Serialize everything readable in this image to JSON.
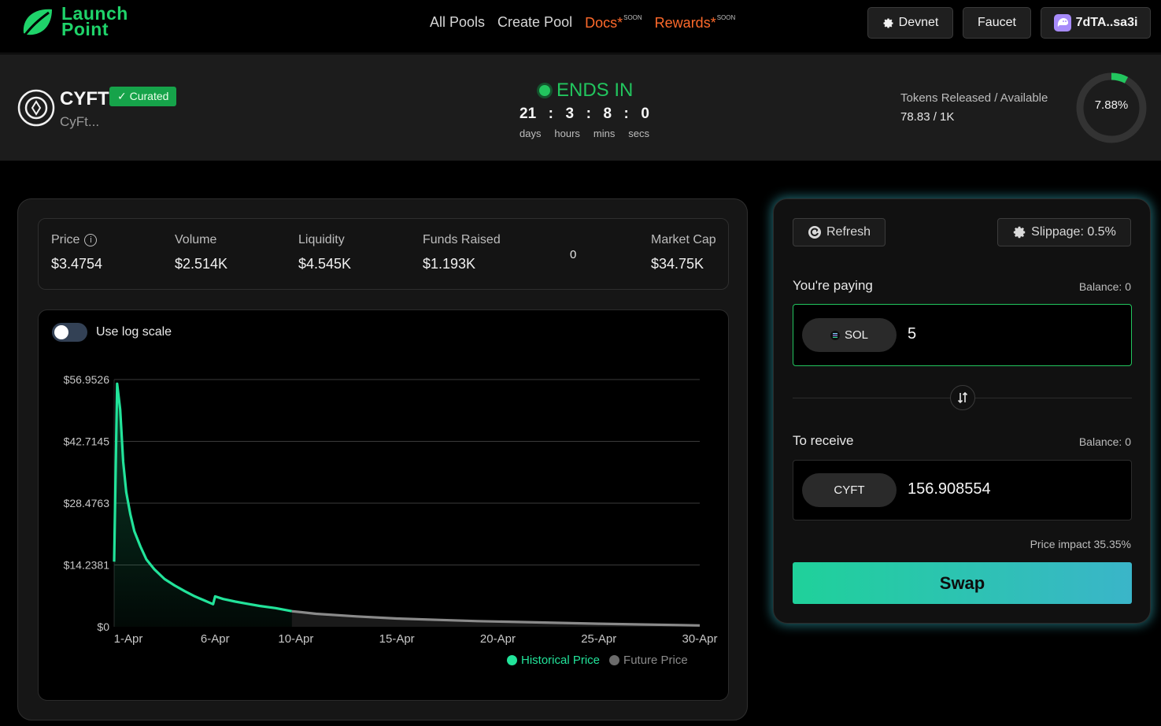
{
  "nav": {
    "logo_line1": "Launch",
    "logo_line2": "Point",
    "links": [
      {
        "label": "All Pools"
      },
      {
        "label": "Create Pool"
      },
      {
        "label": "Docs*",
        "badge": "SOON"
      },
      {
        "label": "Rewards*",
        "badge": "SOON"
      }
    ],
    "network_button": "Devnet",
    "faucet_button": "Faucet",
    "wallet_button": "7dTA..sa3i",
    "brand_color": "#1fd36a",
    "soon_color": "#ff6a2b"
  },
  "token": {
    "symbol": "CYFT",
    "curated_label": "✓ Curated",
    "name": "CyFt...",
    "ends_in_label": "ENDS IN",
    "countdown": {
      "days": "21",
      "hours": "3",
      "mins": "8",
      "secs": "0",
      "days_label": "days",
      "hours_label": "hours",
      "mins_label": "mins",
      "secs_label": "secs"
    },
    "released_label": "Tokens Released / Available",
    "released_value": "78.83 / 1K",
    "released_percent_text": "7.88%",
    "released_fraction": 0.0788
  },
  "stats": {
    "price_label": "Price",
    "price_value": "$3.4754",
    "volume_label": "Volume",
    "volume_value": "$2.514K",
    "liquidity_label": "Liquidity",
    "liquidity_value": "$4.545K",
    "funds_label": "Funds Raised",
    "funds_value": "$1.193K",
    "extra_value": "0",
    "mcap_label": "Market Cap",
    "mcap_value": "$34.75K"
  },
  "chart_toggle_label": "Use log scale",
  "chart_data": {
    "type": "area",
    "log_scale": false,
    "y_ticks": [
      "$56.9526",
      "$42.7145",
      "$28.4763",
      "$14.2381",
      "$0"
    ],
    "y_tick_values": [
      56.9526,
      42.7145,
      28.4763,
      14.2381,
      0
    ],
    "ylim": [
      0,
      56.9526
    ],
    "x_ticks": [
      "1-Apr",
      "6-Apr",
      "10-Apr",
      "15-Apr",
      "20-Apr",
      "25-Apr",
      "30-Apr"
    ],
    "x_tick_days": [
      1,
      6,
      10,
      15,
      20,
      25,
      30
    ],
    "xlim": [
      1,
      30
    ],
    "grid": true,
    "legend_position": "bottom-right",
    "series": [
      {
        "name": "Historical Price",
        "color": "#22e39a",
        "x": [
          1.0,
          1.15,
          1.3,
          1.45,
          1.6,
          1.8,
          2.0,
          2.3,
          2.6,
          3.0,
          3.5,
          4.0,
          4.5,
          5.0,
          5.5,
          5.9,
          6.0,
          6.4,
          7.0,
          7.6,
          8.2,
          9.0,
          9.8
        ],
        "values": [
          15.0,
          56.0,
          50.0,
          38.0,
          31.0,
          26.0,
          22.0,
          18.5,
          15.5,
          13.2,
          11.0,
          9.5,
          8.2,
          7.0,
          6.0,
          5.2,
          7.0,
          6.4,
          5.8,
          5.3,
          4.8,
          4.3,
          3.6
        ]
      },
      {
        "name": "Future Price",
        "color": "#8a8a8a",
        "x": [
          9.8,
          11,
          13,
          15,
          17,
          19,
          21,
          23,
          25,
          27,
          29,
          30
        ],
        "values": [
          3.6,
          3.0,
          2.4,
          1.9,
          1.6,
          1.3,
          1.1,
          0.9,
          0.7,
          0.55,
          0.4,
          0.3
        ]
      }
    ]
  },
  "swap": {
    "refresh_label": "Refresh",
    "slippage_label": "Slippage: 0.5%",
    "paying_label": "You're paying",
    "paying_balance": "Balance: 0",
    "pay_token": "SOL",
    "pay_amount": "5",
    "receive_label": "To receive",
    "receive_balance": "Balance: 0",
    "receive_token": "CYFT",
    "receive_amount": "156.908554",
    "price_impact": "Price impact 35.35%",
    "swap_label": "Swap"
  }
}
